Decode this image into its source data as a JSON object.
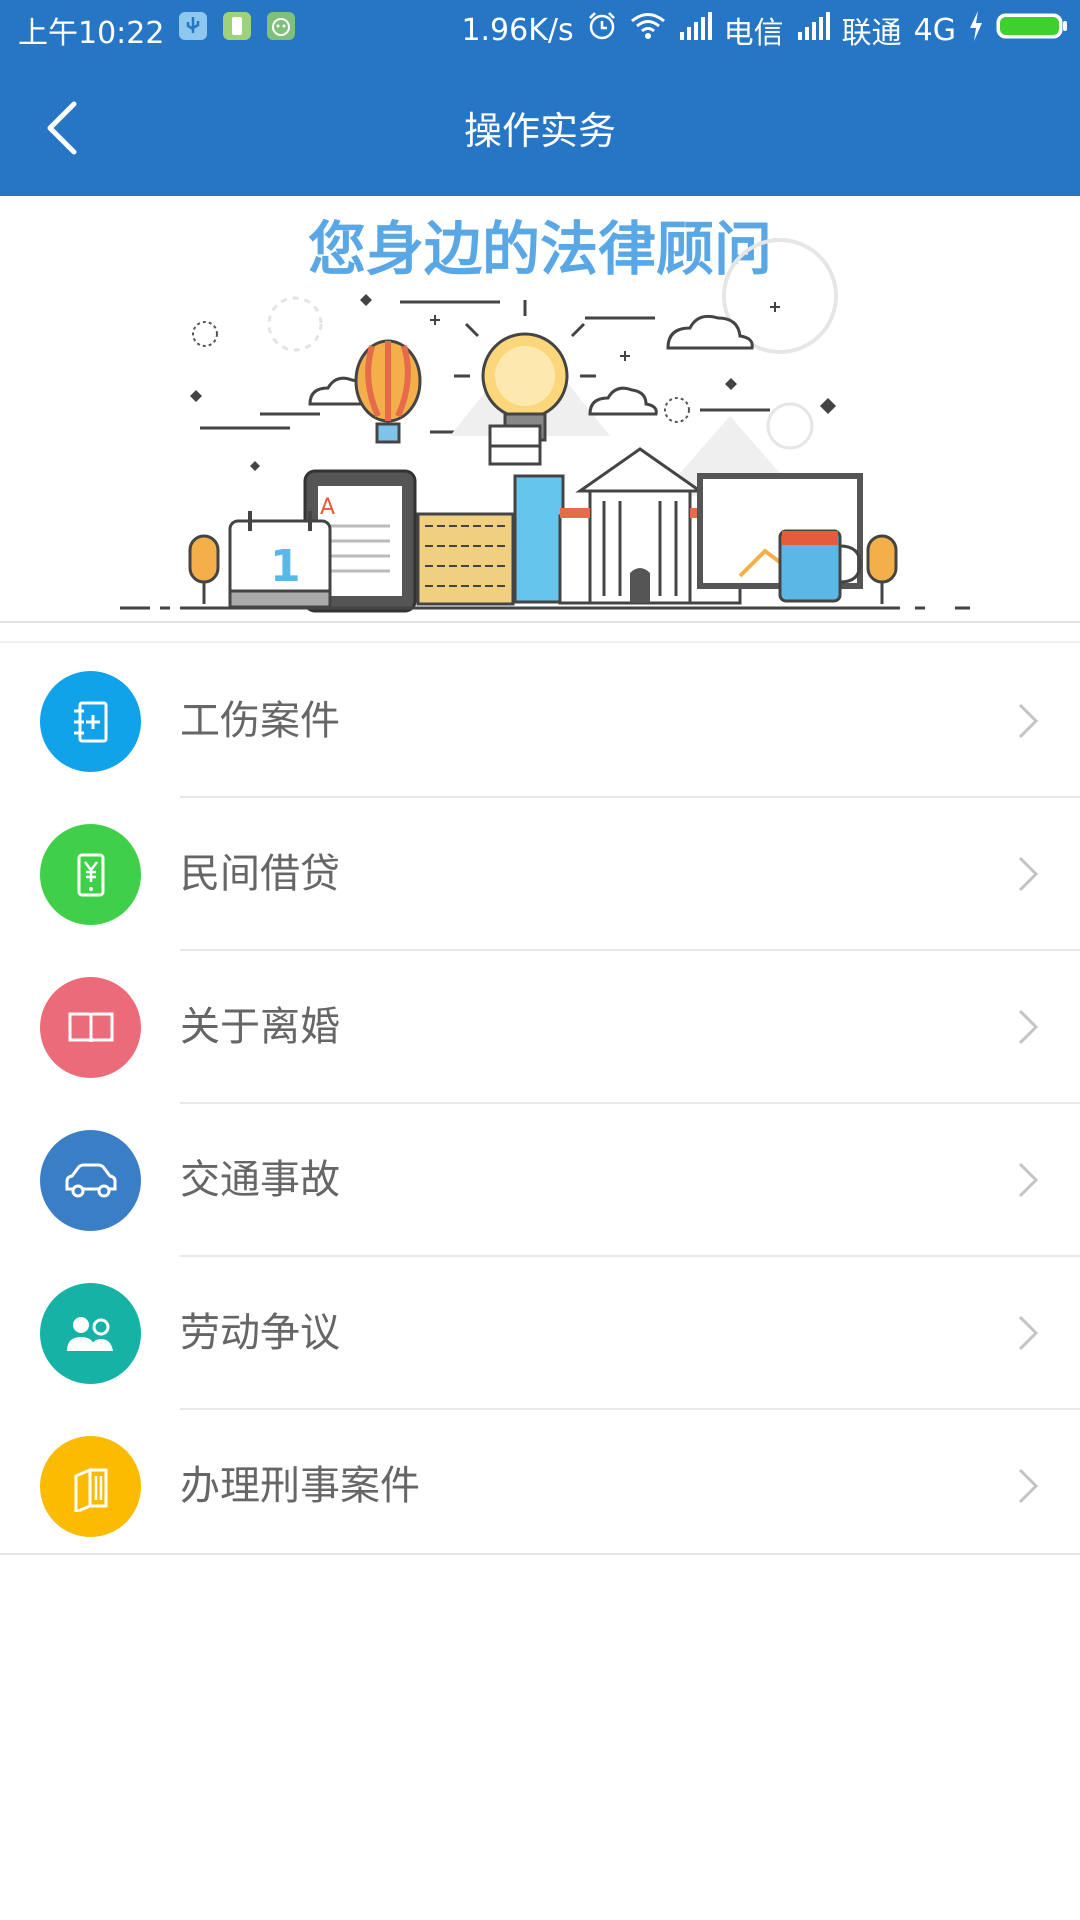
{
  "status_bar": {
    "time": "上午10:22",
    "speed": "1.96K/s",
    "carrier1": "电信",
    "carrier2": "联通",
    "network": "4G",
    "icons": [
      "usb-icon",
      "battery-saver-icon",
      "android-icon",
      "alarm-icon",
      "wifi-icon",
      "signal-icon",
      "charging-icon",
      "battery-icon"
    ]
  },
  "header": {
    "title": "操作实务",
    "back_icon": "chevron-left-icon"
  },
  "banner": {
    "headline": "您身边的法律顾问"
  },
  "menu": {
    "items": [
      {
        "label": "工伤案件",
        "icon": "notebook-plus-icon",
        "color": "#10a3e9"
      },
      {
        "label": "民间借贷",
        "icon": "phone-yen-icon",
        "color": "#3fcf48"
      },
      {
        "label": "关于离婚",
        "icon": "open-book-icon",
        "color": "#ec6b7a"
      },
      {
        "label": "交通事故",
        "icon": "car-icon",
        "color": "#3a7fc6"
      },
      {
        "label": "劳动争议",
        "icon": "people-icon",
        "color": "#15b2a5"
      },
      {
        "label": "办理刑事案件",
        "icon": "book-icon",
        "color": "#fbbb00"
      }
    ]
  },
  "colors": {
    "primary": "#2676c5",
    "text": "#666666",
    "chevron": "#c4c4c4"
  }
}
